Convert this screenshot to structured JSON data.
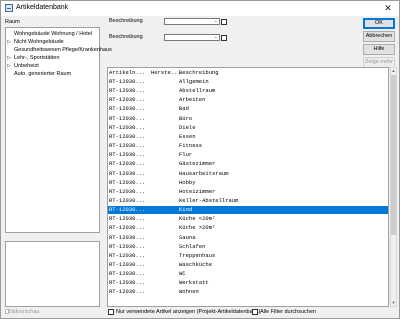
{
  "window": {
    "title": "Artikeldatenbank",
    "close_glyph": "✕"
  },
  "left": {
    "label": "Raum",
    "tree": [
      {
        "label": "Wohngebäude Wohnung / Hotel",
        "expander": ""
      },
      {
        "label": "Nicht Wohngebäude",
        "expander": "▷"
      },
      {
        "label": "Gesundheitswesen Pflege/Krankenhaus",
        "expander": ""
      },
      {
        "label": "Lehr-, Sportstätten",
        "expander": "▷"
      },
      {
        "label": "Unbeheizt",
        "expander": "▷"
      },
      {
        "label": "Auto. generierter Raum",
        "expander": ""
      }
    ],
    "preview_label": "Bildvorschau"
  },
  "filters": {
    "label1": "Beschreibung",
    "label2": "Beschreibung",
    "combo1_value": "",
    "combo2_value": "",
    "combo_arrow": "⌄"
  },
  "buttons": {
    "ok": "OK",
    "cancel": "Abbrechen",
    "help": "Hilfe",
    "more": "Zeige mehr"
  },
  "list": {
    "columns": [
      "Artikeln...",
      "Herste...",
      "Beschreibung"
    ],
    "rows": [
      {
        "article": "RT-12030...",
        "maker": "",
        "desc": "Allgemein"
      },
      {
        "article": "RT-12030...",
        "maker": "",
        "desc": "Abstellraum"
      },
      {
        "article": "RT-12030...",
        "maker": "",
        "desc": "Arbeiten"
      },
      {
        "article": "RT-12030...",
        "maker": "",
        "desc": "Bad"
      },
      {
        "article": "RT-12030...",
        "maker": "",
        "desc": "Büro"
      },
      {
        "article": "RT-12030...",
        "maker": "",
        "desc": "Diele"
      },
      {
        "article": "RT-12030...",
        "maker": "",
        "desc": "Essen"
      },
      {
        "article": "RT-12030...",
        "maker": "",
        "desc": "Fitness"
      },
      {
        "article": "RT-12030...",
        "maker": "",
        "desc": "Flur"
      },
      {
        "article": "RT-12030...",
        "maker": "",
        "desc": "Gästezimmer"
      },
      {
        "article": "RT-12030...",
        "maker": "",
        "desc": "Hausarbeitsraum"
      },
      {
        "article": "RT-12030...",
        "maker": "",
        "desc": "Hobby"
      },
      {
        "article": "RT-12030...",
        "maker": "",
        "desc": "Hoteizimmer"
      },
      {
        "article": "RT-12030...",
        "maker": "",
        "desc": "Keller-Abstellraum"
      },
      {
        "article": "RT-12030...",
        "maker": "",
        "desc": "Kind"
      },
      {
        "article": "RT-12030...",
        "maker": "",
        "desc": "Küche <20m²"
      },
      {
        "article": "RT-12030...",
        "maker": "",
        "desc": "Küche >20m²"
      },
      {
        "article": "RT-12030...",
        "maker": "",
        "desc": "Sauna"
      },
      {
        "article": "RT-12030...",
        "maker": "",
        "desc": "Schlafen"
      },
      {
        "article": "RT-12030...",
        "maker": "",
        "desc": "Treppenhaus"
      },
      {
        "article": "RT-12030...",
        "maker": "",
        "desc": "Waschküche"
      },
      {
        "article": "RT-12030...",
        "maker": "",
        "desc": "WC"
      },
      {
        "article": "RT-12030...",
        "maker": "",
        "desc": "Werkstatt"
      },
      {
        "article": "RT-12030...",
        "maker": "",
        "desc": "Wohnen"
      }
    ],
    "selected_index": 14
  },
  "scroll": {
    "up": "▲",
    "down": "▼"
  },
  "bottom": {
    "unused_label": "Nur verwendete Artikel anzeigen (Projekt-Artikeldatenbank)",
    "all_filters_label": "Alle Filter durchsuchen"
  },
  "colors": {
    "selection": "#0078d7",
    "default_button_border": "#0078d7"
  }
}
